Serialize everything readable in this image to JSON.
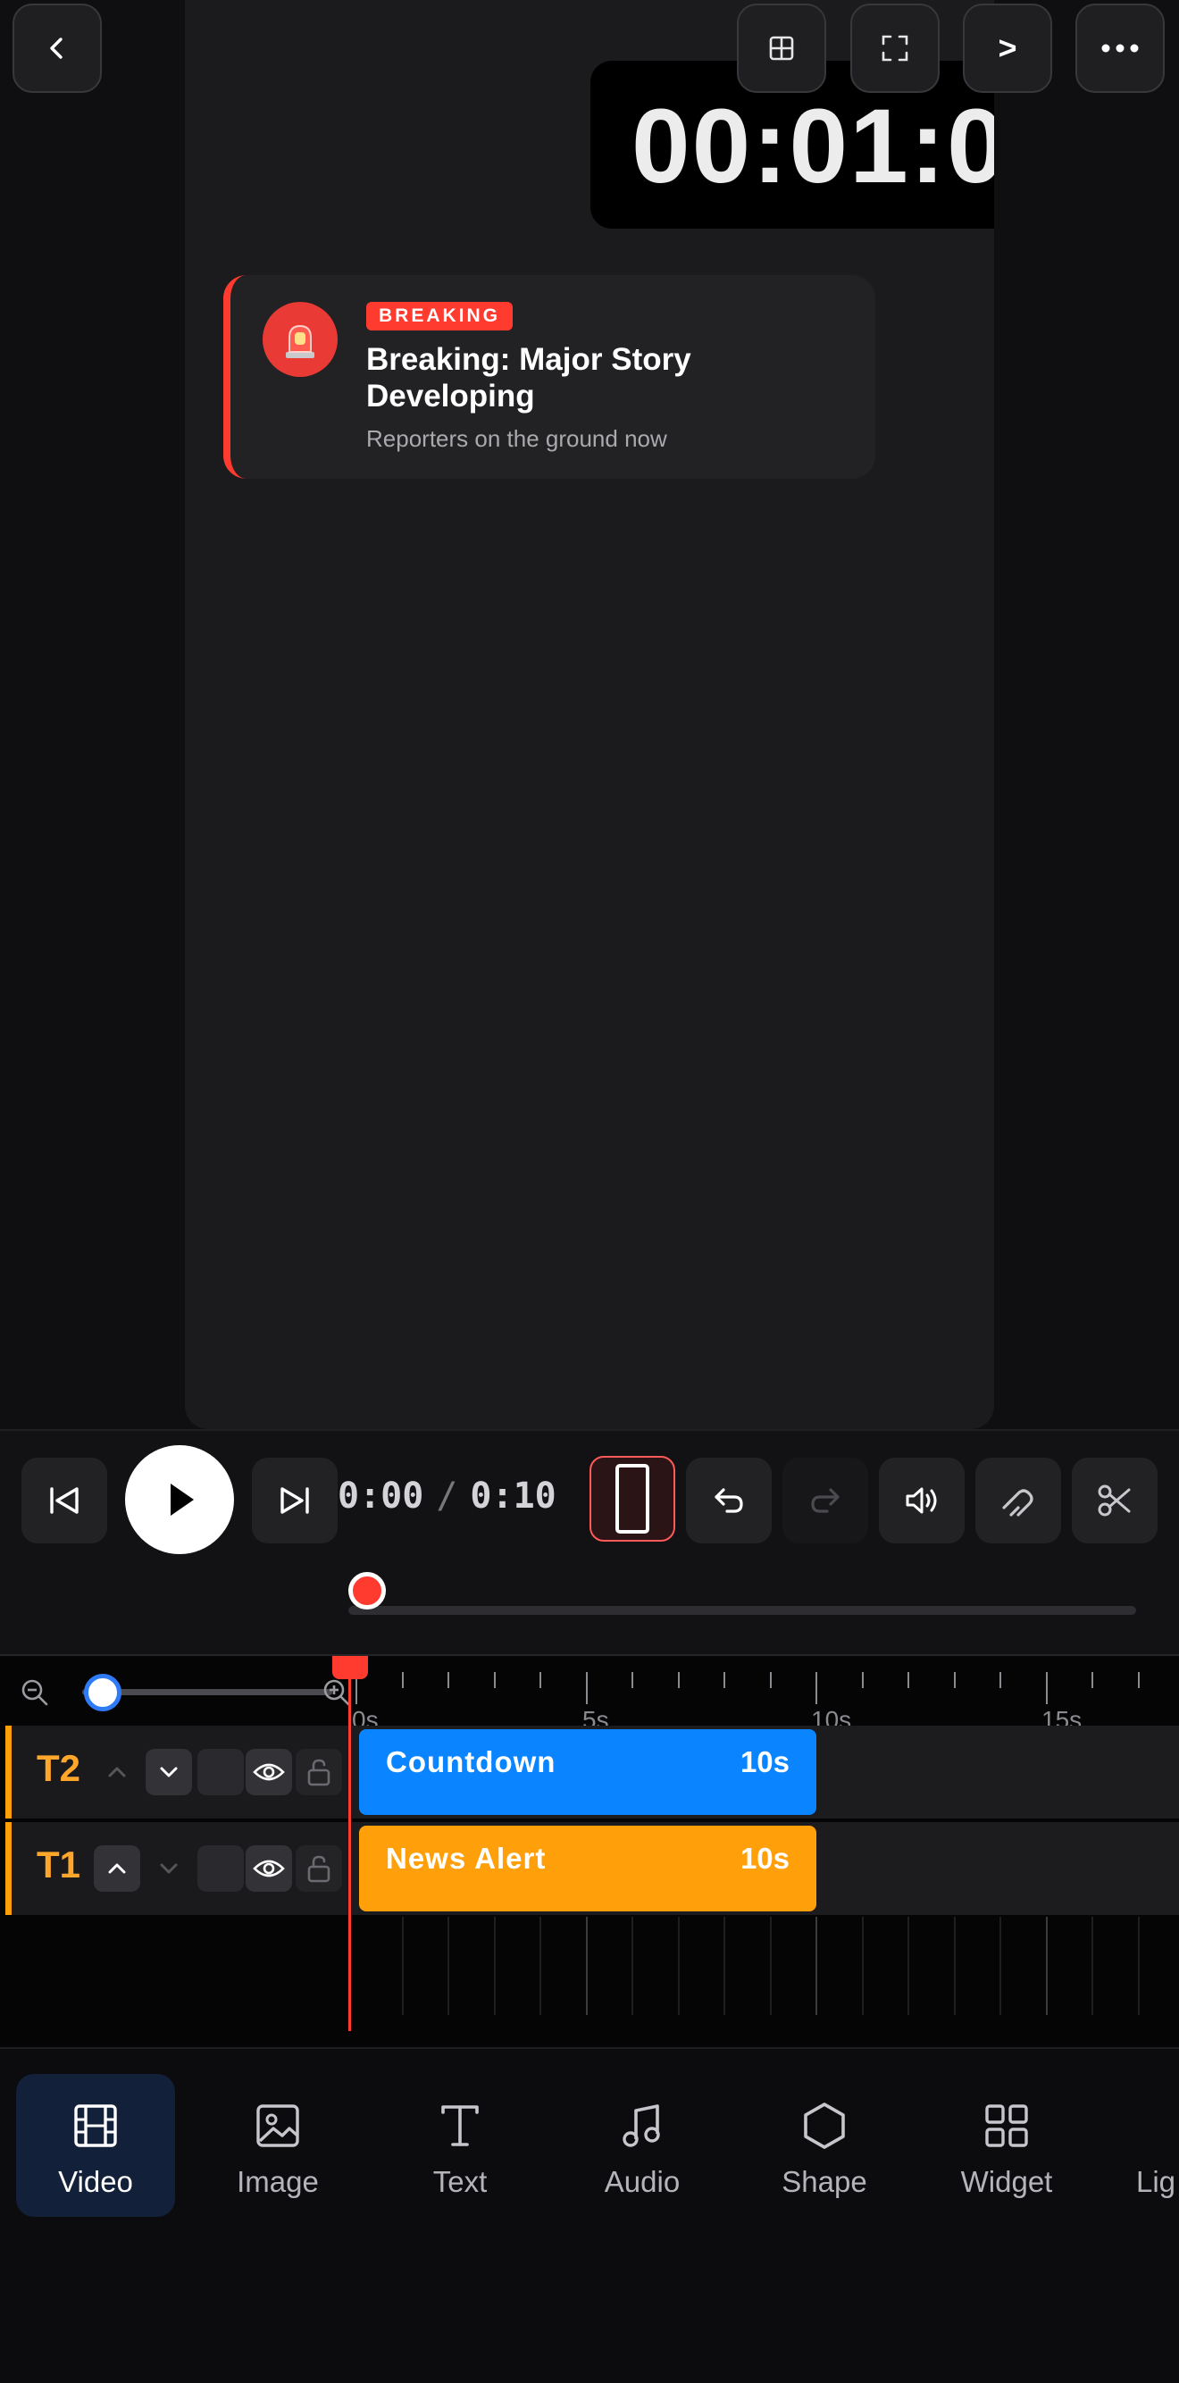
{
  "preview": {
    "timer_text": "00:01:0",
    "alert": {
      "badge": "BREAKING",
      "title": "Breaking: Major Story Developing",
      "subtitle": "Reporters on the ground now",
      "accent": "#ff3b30"
    }
  },
  "top_bar": {
    "next_label": ">"
  },
  "controls": {
    "current_time": "0:00",
    "separator": "/",
    "total_time": "0:10"
  },
  "timeline": {
    "ruler_labels": [
      "0s",
      "5s",
      "10s",
      "15s"
    ],
    "tracks": [
      {
        "name": "T2",
        "clip_label": "Countdown",
        "clip_duration": "10s",
        "clip_color": "#0a84ff"
      },
      {
        "name": "T1",
        "clip_label": "News Alert",
        "clip_duration": "10s",
        "clip_color": "#ff9f0a"
      }
    ]
  },
  "tabs": [
    {
      "label": "Video",
      "icon": "film-icon",
      "active": true
    },
    {
      "label": "Image",
      "icon": "image-icon"
    },
    {
      "label": "Text",
      "icon": "text-icon"
    },
    {
      "label": "Audio",
      "icon": "music-icon"
    },
    {
      "label": "Shape",
      "icon": "hexagon-icon"
    },
    {
      "label": "Widget",
      "icon": "grid-icon"
    },
    {
      "label": "Lig",
      "icon": ""
    }
  ]
}
